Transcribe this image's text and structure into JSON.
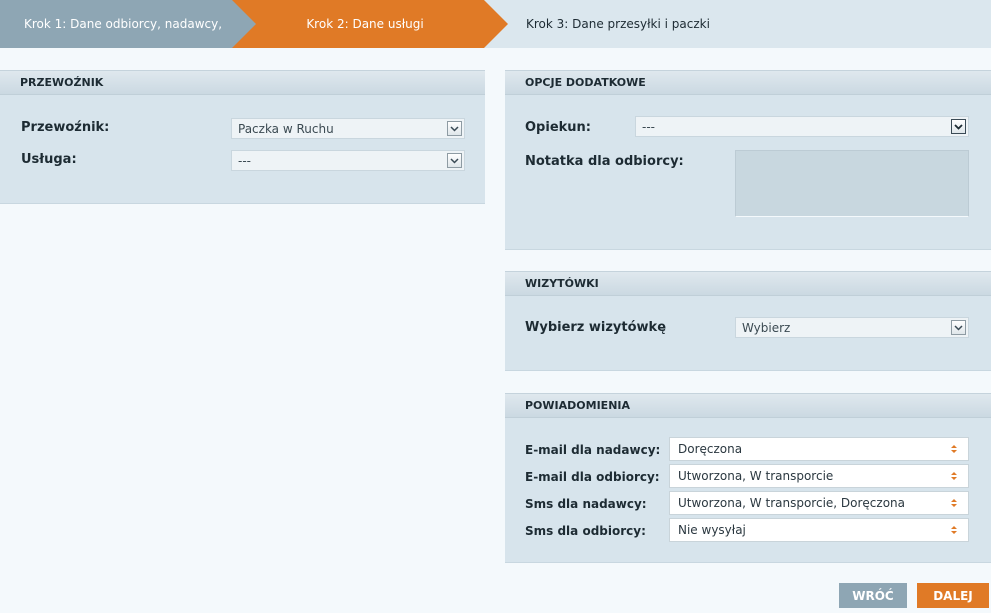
{
  "steps": {
    "step1": "Krok 1: Dane odbiorcy, nadawcy,",
    "step2": "Krok 2: Dane usługi",
    "step3": "Krok 3: Dane przesyłki i paczki"
  },
  "carrier_panel": {
    "title": "PRZEWOŹNIK",
    "carrier_label": "Przewoźnik:",
    "carrier_value": "Paczka w Ruchu",
    "service_label": "Usługa:",
    "service_value": "---"
  },
  "options_panel": {
    "title": "OPCJE DODATKOWE",
    "guardian_label": "Opiekun:",
    "guardian_value": "---",
    "note_label": "Notatka dla odbiorcy:"
  },
  "cards_panel": {
    "title": "WIZYTÓWKI",
    "choose_label": "Wybierz wizytówkę",
    "choose_value": "Wybierz"
  },
  "notifications_panel": {
    "title": "POWIADOMIENIA",
    "rows": [
      {
        "label": "E-mail dla nadawcy:",
        "value": "Doręczona"
      },
      {
        "label": "E-mail dla odbiorcy:",
        "value": "Utworzona, W transporcie"
      },
      {
        "label": "Sms dla nadawcy:",
        "value": "Utworzona, W transporcie, Doręczona"
      },
      {
        "label": "Sms dla odbiorcy:",
        "value": "Nie wysyłaj"
      }
    ]
  },
  "buttons": {
    "back": "WRÓĆ",
    "next": "DALEJ"
  },
  "colors": {
    "accent": "#e07a26",
    "step_inactive": "#8ea6b4",
    "panel_bg": "#d7e4ec"
  }
}
